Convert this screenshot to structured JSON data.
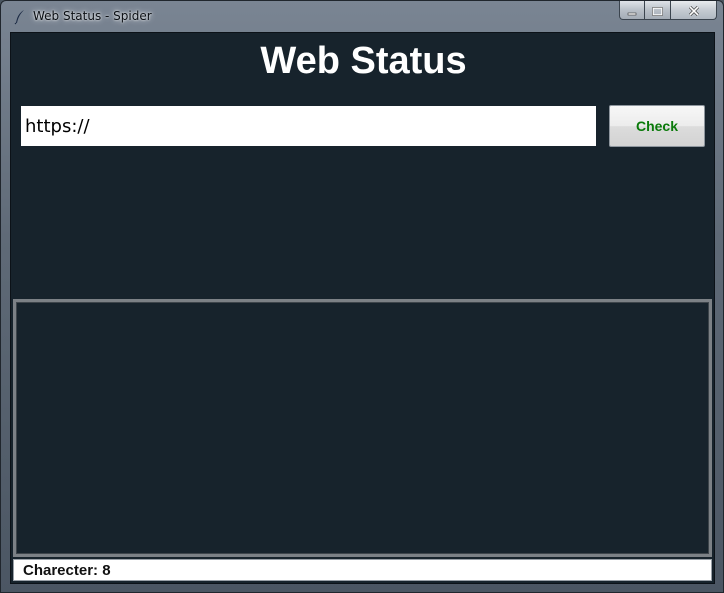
{
  "window": {
    "title": "Web Status - Spider",
    "icon": "feather-icon"
  },
  "caption_buttons": {
    "minimize_icon": "minimize-icon",
    "maximize_icon": "maximize-icon",
    "close_icon": "close-icon"
  },
  "main": {
    "heading": "Web Status",
    "url_value": "https://",
    "check_label": "Check",
    "check_color": "#0a7a0a",
    "output_text": ""
  },
  "status_bar": {
    "text": "Charecter: 8"
  },
  "colors": {
    "background": "#17232c",
    "heading": "#ffffff",
    "input_background": "#ffffff"
  }
}
